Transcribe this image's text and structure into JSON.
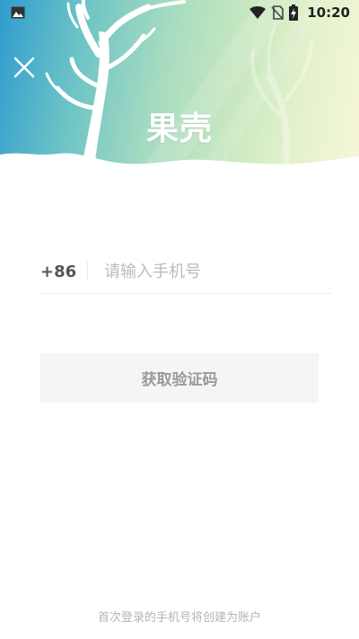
{
  "status_bar": {
    "time": "10:20",
    "icons": [
      "image-notification-icon",
      "wifi-icon",
      "no-sim-icon",
      "battery-charging-icon"
    ]
  },
  "header": {
    "brand": "果壳",
    "close_icon": "close-icon"
  },
  "login": {
    "country_code": "+86",
    "phone_placeholder": "请输入手机号",
    "phone_value": "",
    "get_code_label": "获取验证码"
  },
  "footer": {
    "note": "首次登录的手机号将创建为账户"
  },
  "colors": {
    "hero_gradient_start": "#2f9ccf",
    "hero_gradient_end": "#f6f6d8",
    "button_bg": "#f5f5f5",
    "button_text": "#9a9a9a",
    "placeholder": "#bbbbbb"
  }
}
